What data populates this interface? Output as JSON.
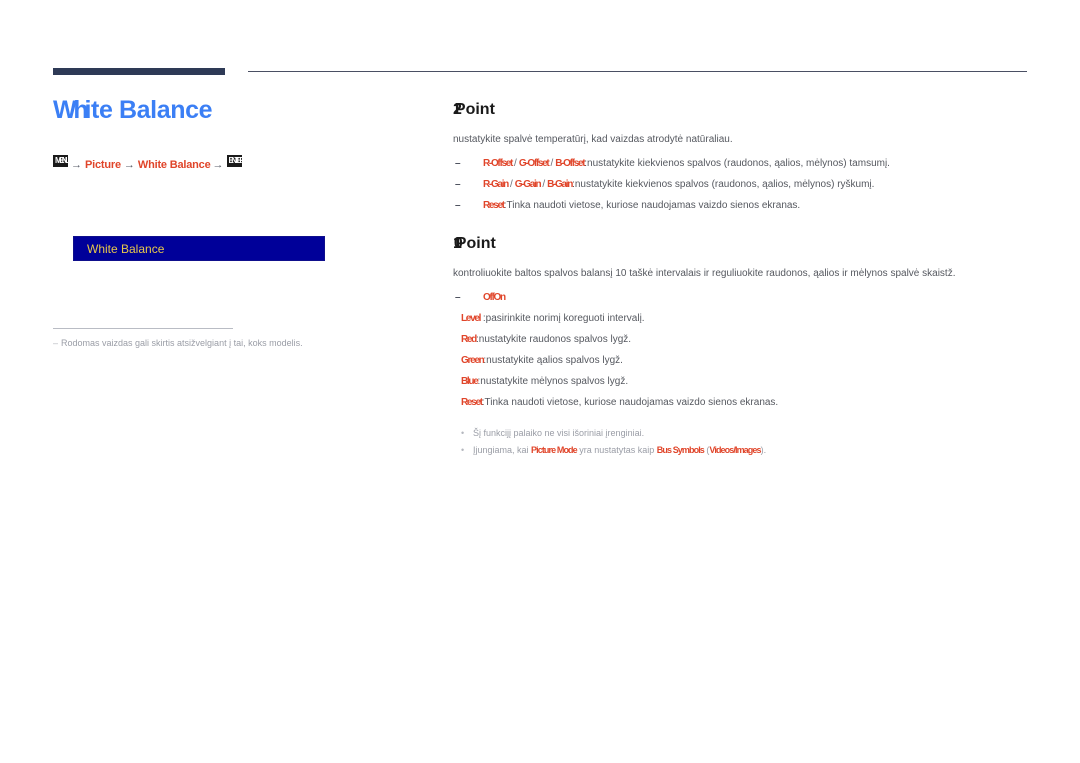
{
  "page": {
    "title": "White Balance",
    "title_lead": "Wh",
    "title_rest": "ite Balance"
  },
  "breadcrumb": {
    "menu_icon": "MENU",
    "level1": "Picture",
    "level2": "White Balance",
    "enter_icon": "ENTER",
    "separator": "→"
  },
  "osd": {
    "item_label": "White Balance"
  },
  "left_note": {
    "marker": "–",
    "text": "Rodomas vaizdas gali skirtis atsižvelgiant į tai, koks modelis."
  },
  "sections": [
    {
      "heading_num": "2",
      "heading_text": "Point",
      "intro": "nustatykite spalvė temperatūrį, kad vaizdas atrodytė natūraliau.",
      "bullets": [
        {
          "marker": "–",
          "options": [
            "R-Offset",
            "G-Offset",
            "B-Offset"
          ],
          "desc": ":nustatykite kiekvienos spalvos (raudonos, ąalios, mėlynos) tamsumį."
        },
        {
          "marker": "–",
          "options": [
            "R-Gain",
            "G-Gain",
            "B-Gain"
          ],
          "desc": ":nustatykite kiekvienos spalvos (raudonos, ąalios, mėlynos) ryškumį."
        },
        {
          "marker": "–",
          "options": [
            "Reset"
          ],
          "desc": ":Tinka naudoti vietose, kuriose naudojamas vaizdo sienos ekranas."
        }
      ]
    },
    {
      "heading_num": "10",
      "heading_text": "Point",
      "intro": "kontroliuokite baltos spalvos balansį 10 taškė intervalais ir reguliuokite raudonos, ąalios ir mėlynos spalvė skaistž.",
      "bullets": [
        {
          "marker": "–",
          "options": [
            "Off",
            "On"
          ],
          "desc": ""
        },
        {
          "marker": "",
          "options": [
            "Level"
          ],
          "desc": " :pasirinkite norimį koreguoti intervalį."
        },
        {
          "marker": "",
          "options": [
            "Red"
          ],
          "desc": ":nustatykite raudonos spalvos lygž."
        },
        {
          "marker": "",
          "options": [
            "Green"
          ],
          "desc": ":nustatykite ąalios spalvos lygž."
        },
        {
          "marker": "",
          "options": [
            "Blue"
          ],
          "desc": ":nustatykite mėlynos spalvos lygž."
        },
        {
          "marker": "",
          "options": [
            "Reset"
          ],
          "desc": ":Tinka naudoti vietose, kuriose naudojamas vaizdo sienos ekranas."
        }
      ],
      "notes": [
        {
          "marker": "•",
          "pre": "Šį funkcijį palaiko ne visi išoriniai įrenginiai.",
          "hl1": "",
          "mid": "",
          "hl2": "",
          "post": ""
        },
        {
          "marker": "•",
          "pre": "Įjungiama, kai ",
          "hl1": "Picture Mode",
          "mid": " yra nustatytas kaip ",
          "hl2": "Bus Symbols",
          "post": " (Videos/Images).",
          "post_hl": "Videos/Images"
        }
      ]
    }
  ]
}
